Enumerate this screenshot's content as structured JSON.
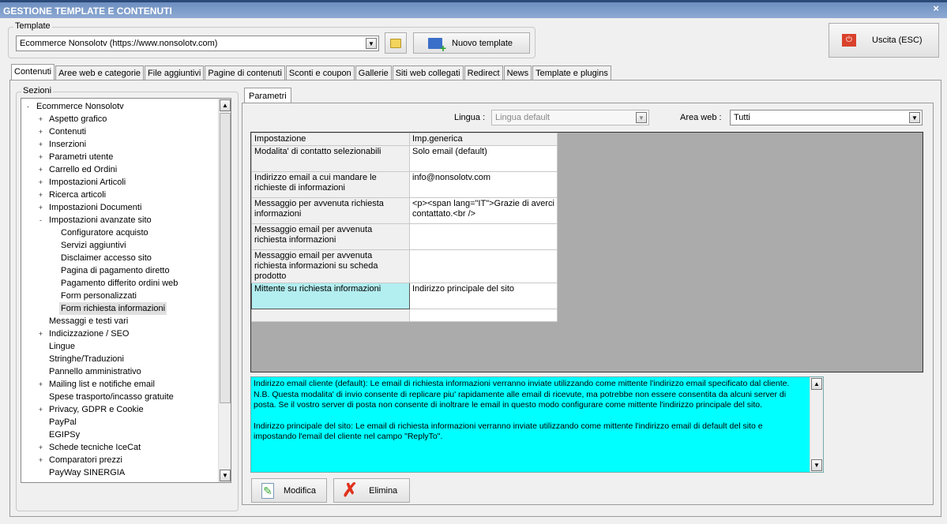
{
  "window": {
    "title": "GESTIONE TEMPLATE E CONTENUTI",
    "close": "×"
  },
  "template": {
    "group_label": "Template",
    "selected": "Ecommerce Nonsolotv (https://www.nonsolotv.com)",
    "new_label": "Nuovo template",
    "exit_label": "Uscita (ESC)"
  },
  "tabs": [
    "Contenuti",
    "Aree web e categorie",
    "File aggiuntivi",
    "Pagine di contenuti",
    "Sconti e coupon",
    "Gallerie",
    "Siti web collegati",
    "Redirect",
    "News",
    "Template e plugins"
  ],
  "sections": {
    "label": "Sezioni",
    "tree": [
      {
        "label": "Ecommerce Nonsolotv",
        "level": 0,
        "expander": "-"
      },
      {
        "label": "Aspetto grafico",
        "level": 1,
        "expander": "+"
      },
      {
        "label": "Contenuti",
        "level": 1,
        "expander": "+"
      },
      {
        "label": "Inserzioni",
        "level": 1,
        "expander": "+"
      },
      {
        "label": "Parametri utente",
        "level": 1,
        "expander": "+"
      },
      {
        "label": "Carrello ed Ordini",
        "level": 1,
        "expander": "+"
      },
      {
        "label": "Impostazioni Articoli",
        "level": 1,
        "expander": "+"
      },
      {
        "label": "Ricerca articoli",
        "level": 1,
        "expander": "+"
      },
      {
        "label": "Impostazioni Documenti",
        "level": 1,
        "expander": "+"
      },
      {
        "label": "Impostazioni avanzate sito",
        "level": 1,
        "expander": "-"
      },
      {
        "label": "Configuratore acquisto",
        "level": 2,
        "expander": ""
      },
      {
        "label": "Servizi aggiuntivi",
        "level": 2,
        "expander": ""
      },
      {
        "label": "Disclaimer accesso sito",
        "level": 2,
        "expander": ""
      },
      {
        "label": "Pagina di pagamento diretto",
        "level": 2,
        "expander": ""
      },
      {
        "label": "Pagamento differito ordini web",
        "level": 2,
        "expander": ""
      },
      {
        "label": "Form personalizzati",
        "level": 2,
        "expander": ""
      },
      {
        "label": "Form richiesta informazioni",
        "level": 2,
        "expander": "",
        "selected": true
      },
      {
        "label": "Messaggi e testi vari",
        "level": 1,
        "expander": ""
      },
      {
        "label": "Indicizzazione / SEO",
        "level": 1,
        "expander": "+"
      },
      {
        "label": "Lingue",
        "level": 1,
        "expander": ""
      },
      {
        "label": "Stringhe/Traduzioni",
        "level": 1,
        "expander": ""
      },
      {
        "label": "Pannello amministrativo",
        "level": 1,
        "expander": ""
      },
      {
        "label": "Mailing list e notifiche email",
        "level": 1,
        "expander": "+"
      },
      {
        "label": "Spese trasporto/incasso gratuite",
        "level": 1,
        "expander": ""
      },
      {
        "label": "Privacy, GDPR e Cookie",
        "level": 1,
        "expander": "+"
      },
      {
        "label": "PayPal",
        "level": 1,
        "expander": ""
      },
      {
        "label": "EGIPSy",
        "level": 1,
        "expander": ""
      },
      {
        "label": "Schede tecniche IceCat",
        "level": 1,
        "expander": "+"
      },
      {
        "label": "Comparatori prezzi",
        "level": 1,
        "expander": "+"
      },
      {
        "label": "PayWay SINERGIA",
        "level": 1,
        "expander": ""
      }
    ]
  },
  "params": {
    "tab": "Parametri",
    "lingua_label": "Lingua :",
    "lingua_value": "Lingua default",
    "area_label": "Area web :",
    "area_value": "Tutti",
    "headers": [
      "Impostazione",
      "Imp.generica"
    ],
    "rows": [
      [
        "Modalita' di contatto selezionabili",
        "Solo email (default)"
      ],
      [
        "Indirizzo email a cui mandare le richieste di informazioni",
        "info@nonsolotv.com"
      ],
      [
        "Messaggio per avvenuta richiesta informazioni",
        "<p><span lang=\"IT\">Grazie di averci contattato.<br />"
      ],
      [
        "Messaggio email per avvenuta richiesta informazioni",
        ""
      ],
      [
        "Messaggio email per avvenuta richiesta informazioni su scheda prodotto",
        ""
      ],
      [
        "Mittente su richiesta informazioni",
        "Indirizzo principale del sito"
      ]
    ],
    "description": [
      "Indirizzo email cliente (default): Le email di richiesta informazioni verranno inviate utilizzando come mittente l'indirizzo email specificato dal cliente. N.B. Questa modalita' di invio consente di replicare piu' rapidamente alle email di ricevute, ma potrebbe non essere consentita da alcuni server di posta. Se il vostro server di posta non consente di inoltrare le email in questo modo configurare come mittente l'indirizzo principale del sito.",
      "Indirizzo principale del sito: Le email di richiesta informazioni verranno inviate utilizzando come mittente l'indirizzo email di default del sito e impostando l'email del cliente nel campo \"ReplyTo\"."
    ],
    "edit_label": "Modifica",
    "delete_label": "Elimina"
  },
  "colors": {
    "selected_row": "#b3eef0",
    "description_bg": "#00ffff",
    "grid_bg": "#ababab"
  }
}
